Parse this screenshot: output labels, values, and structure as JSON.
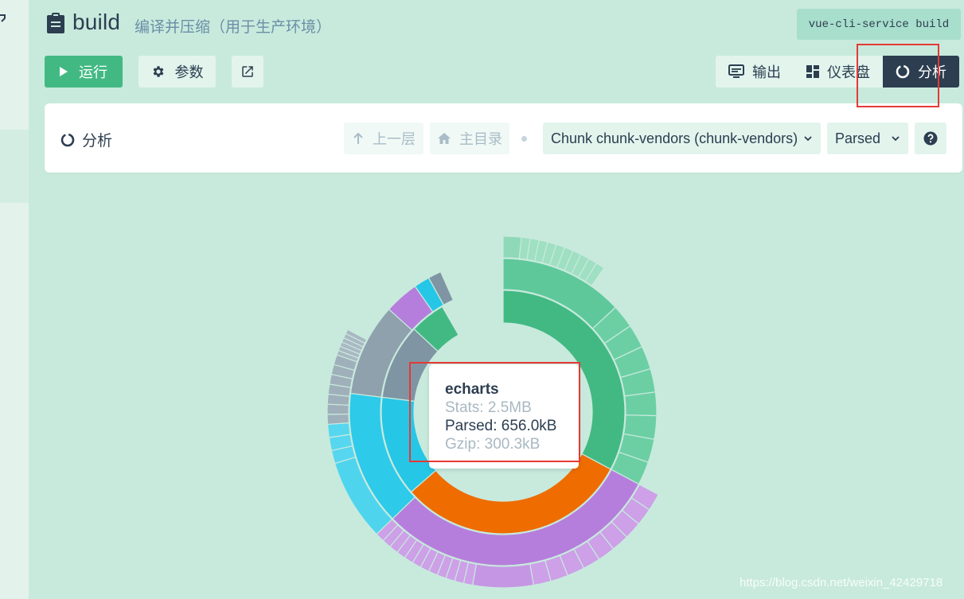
{
  "header": {
    "title": "build",
    "description": "编译并压缩（用于生产环境）",
    "command": "vue-cli-service build"
  },
  "toolbar": {
    "run_label": "运行",
    "params_label": "参数"
  },
  "views": {
    "output_label": "输出",
    "dashboard_label": "仪表盘",
    "analyze_label": "分析"
  },
  "analyzer": {
    "title": "分析",
    "up_label": "上一层",
    "home_label": "主目录",
    "chunk_select": "Chunk chunk-vendors (chunk-vendors)",
    "mode_select": "Parsed"
  },
  "tooltip": {
    "name": "echarts",
    "stats": "Stats: 2.5MB",
    "parsed": "Parsed: 656.0kB",
    "gzip": "Gzip: 300.3kB"
  },
  "watermark": "https://blog.csdn.net/weixin_42429718",
  "colors": {
    "accent": "#42b983",
    "dark": "#2c3e50",
    "background": "#c8eadd",
    "highlight": "#e53935",
    "orange": "#ef6c00",
    "purple": "#b57edc",
    "cyan": "#26c6e6",
    "gray": "#7f95a3"
  }
}
